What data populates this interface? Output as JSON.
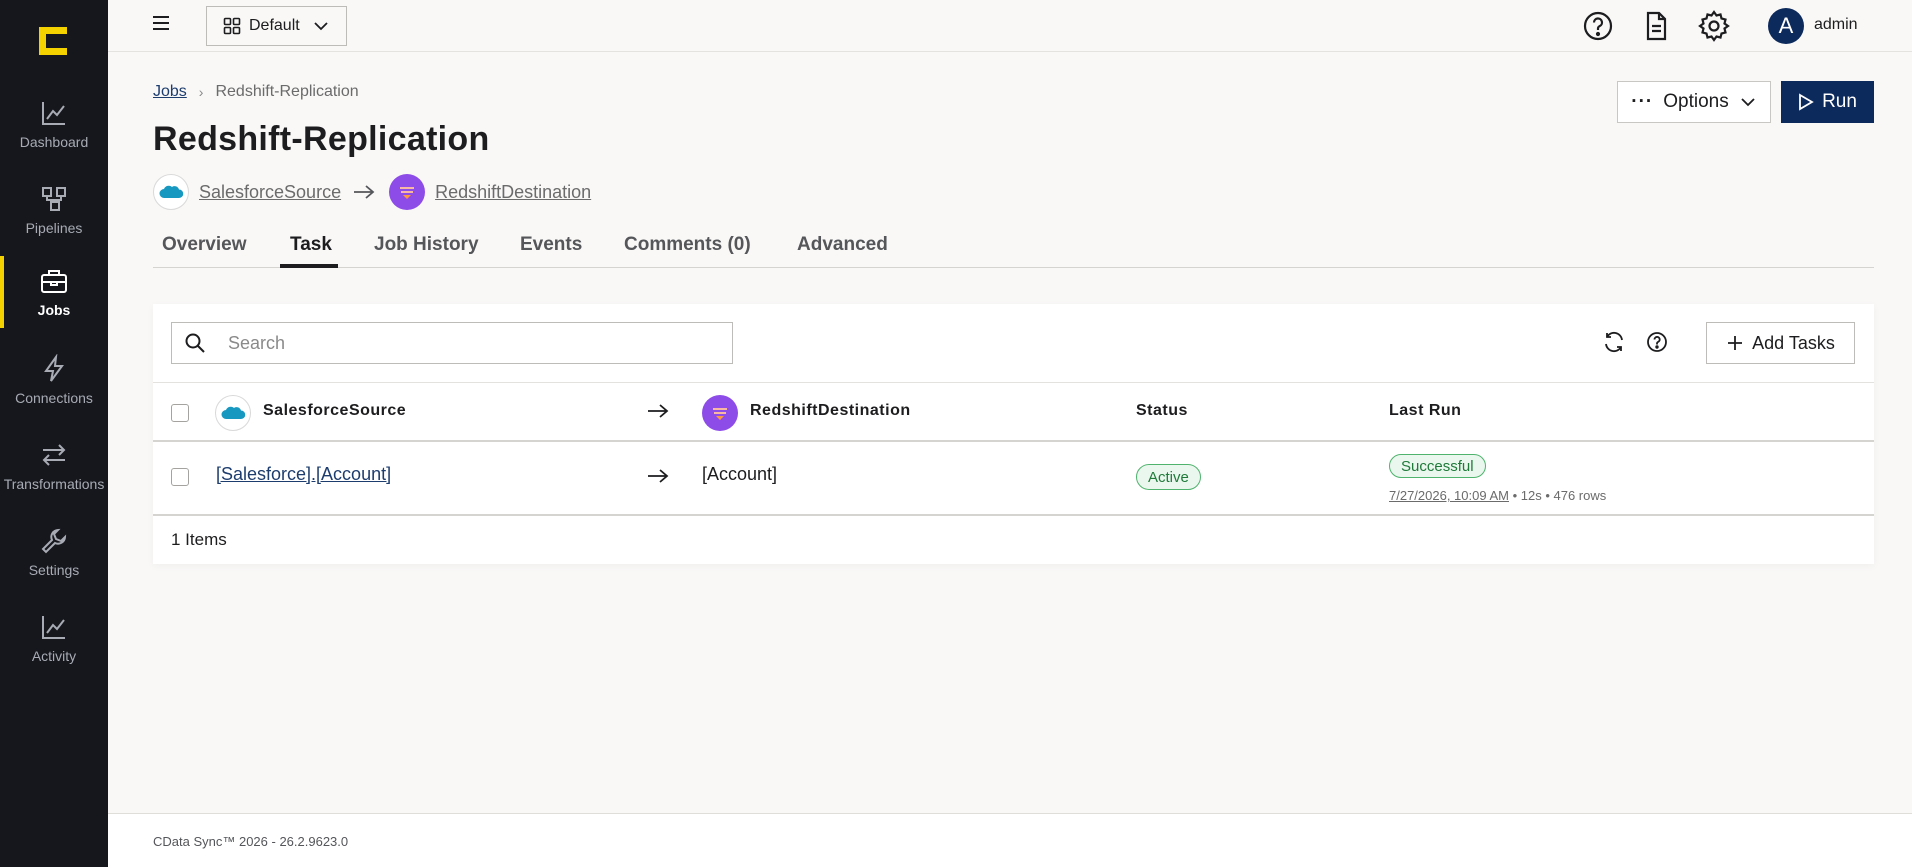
{
  "sidebar": {
    "logo": "cdata-logo",
    "items": [
      {
        "label": "Dashboard",
        "icon": "chart-line-icon"
      },
      {
        "label": "Pipelines",
        "icon": "pipeline-icon"
      },
      {
        "label": "Jobs",
        "icon": "briefcase-icon",
        "active": true
      },
      {
        "label": "Connections",
        "icon": "lightning-icon"
      },
      {
        "label": "Transformations",
        "icon": "arrows-swap-icon"
      },
      {
        "label": "Settings",
        "icon": "wrench-icon"
      },
      {
        "label": "Activity",
        "icon": "chart-line-icon"
      }
    ]
  },
  "topbar": {
    "workspace_label": "Default",
    "user_initial": "A",
    "username": "admin"
  },
  "breadcrumb": {
    "root": "Jobs",
    "current": "Redshift-Replication"
  },
  "page": {
    "title": "Redshift-Replication",
    "options_label": "Options",
    "run_label": "Run",
    "source_name": "SalesforceSource",
    "destination_name": "RedshiftDestination"
  },
  "tabs": [
    {
      "label": "Overview"
    },
    {
      "label": "Task",
      "active": true
    },
    {
      "label": "Job History"
    },
    {
      "label": "Events"
    },
    {
      "label": "Comments (0)"
    },
    {
      "label": "Advanced"
    }
  ],
  "task_panel": {
    "search_placeholder": "Search",
    "add_tasks_label": "Add Tasks",
    "columns": {
      "source": "SalesforceSource",
      "destination": "RedshiftDestination",
      "status": "Status",
      "last_run": "Last Run"
    },
    "rows": [
      {
        "source": "[Salesforce].[Account]",
        "destination": "[Account]",
        "status": "Active",
        "last_run_result": "Successful",
        "last_run_time": "7/27/2026, 10:09 AM",
        "last_run_details": "• 12s • 476 rows"
      }
    ],
    "items_count": "1 Items"
  },
  "footer": {
    "text": "CData Sync™ 2026 - 26.2.9623.0"
  },
  "colors": {
    "sidebar_bg": "#16171d",
    "accent_yellow": "#f4d200",
    "primary_navy": "#0d2a5c",
    "success_green": "#1f7a3a",
    "redshift_purple": "#8d4ce8",
    "salesforce_blue": "#1798c1"
  }
}
